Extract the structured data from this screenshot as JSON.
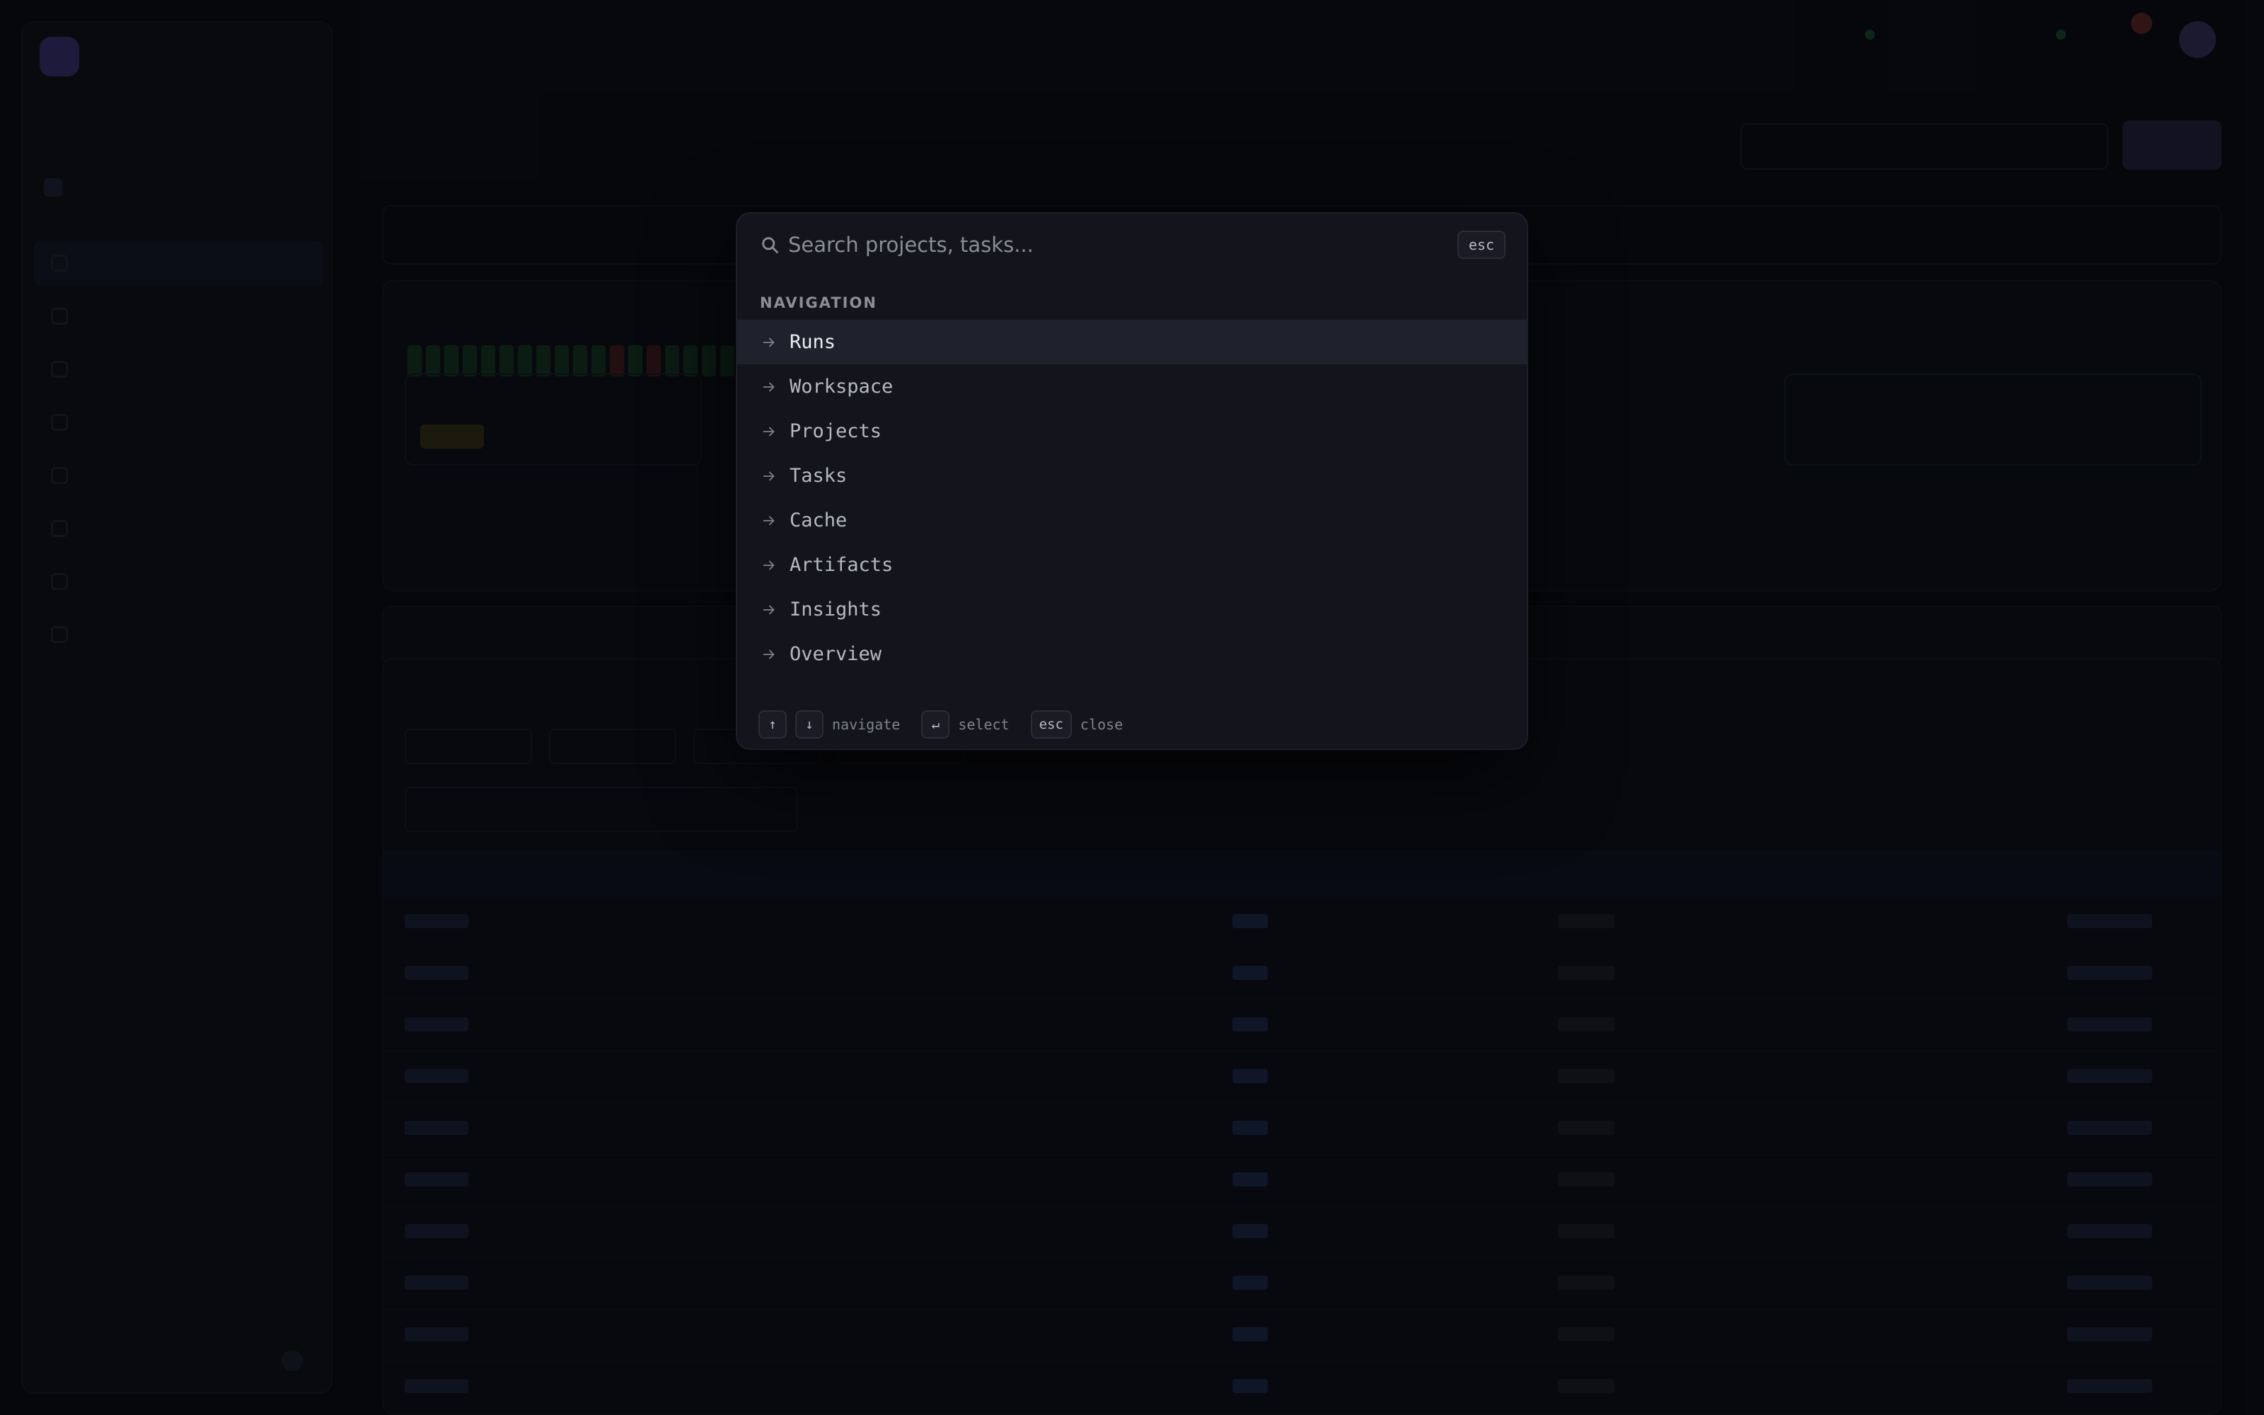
{
  "palette": {
    "search_placeholder": "Search projects, tasks...",
    "esc_label": "esc",
    "section_label": "NAVIGATION",
    "items": [
      {
        "label": "Runs",
        "active": true
      },
      {
        "label": "Workspace"
      },
      {
        "label": "Projects"
      },
      {
        "label": "Tasks"
      },
      {
        "label": "Cache"
      },
      {
        "label": "Artifacts"
      },
      {
        "label": "Insights"
      },
      {
        "label": "Overview"
      }
    ],
    "footer": {
      "up_key": "↑",
      "down_key": "↓",
      "navigate_label": "navigate",
      "enter_key": "↵",
      "select_label": "select",
      "esc_key": "esc",
      "close_label": "close"
    }
  },
  "colors": {
    "overlay_bg": "#13141c",
    "active_item_bg": "#1f212c",
    "page_bg": "#08090d"
  },
  "icons": {
    "search": "search-icon",
    "item_arrow": "arrow-right-icon"
  }
}
